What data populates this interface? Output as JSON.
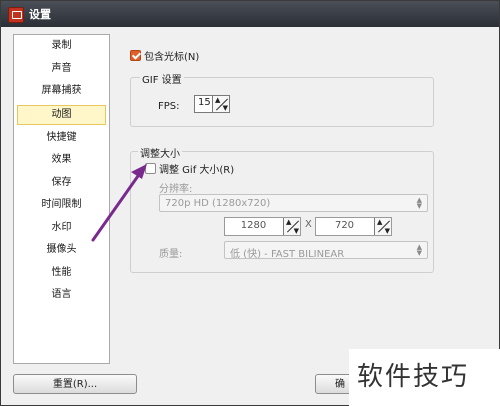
{
  "window": {
    "title": "设置"
  },
  "sidebar": {
    "items": [
      {
        "label": "录制"
      },
      {
        "label": "声音"
      },
      {
        "label": "屏幕捕获"
      },
      {
        "label": "动图",
        "selected": true
      },
      {
        "label": "快捷键"
      },
      {
        "label": "效果"
      },
      {
        "label": "保存"
      },
      {
        "label": "时间限制"
      },
      {
        "label": "水印"
      },
      {
        "label": "摄像头"
      },
      {
        "label": "性能"
      },
      {
        "label": "语言"
      }
    ]
  },
  "content": {
    "include_cursor": {
      "label": "包含光标(N)",
      "checked": true
    },
    "gif_settings": {
      "title": "GIF 设置",
      "fps_label": "FPS:",
      "fps_value": "15"
    },
    "resize": {
      "title": "调整大小",
      "resize_gif": {
        "label": "调整 Gif 大小(R)",
        "checked": false
      },
      "resolution_label": "分辨率:",
      "resolution_value": "720p HD (1280x720)",
      "width_value": "1280",
      "separator": "X",
      "height_value": "720",
      "quality_label": "质量:",
      "quality_value": "低 (快) - FAST BILINEAR"
    }
  },
  "footer": {
    "reset_label": "重置(R)...",
    "ok_label": "确"
  },
  "watermark": {
    "text": "软件技巧"
  },
  "colors": {
    "accent": "#e0602a",
    "selected_bg": "#fff6c9",
    "annotation_arrow": "#7a2a8e"
  },
  "icons": {
    "app": "app-icon",
    "spin": "spin-arrows-icon",
    "combo": "dropdown-arrow-icon"
  }
}
